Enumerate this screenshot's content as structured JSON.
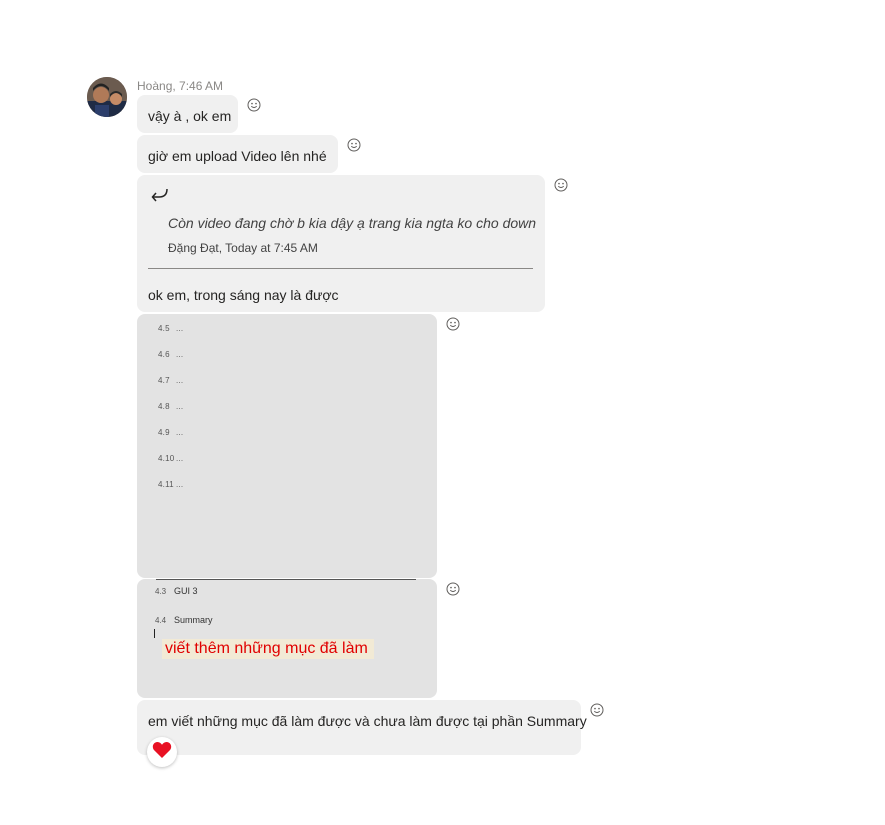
{
  "sender": {
    "name_time": "Hoàng, 7:46 AM"
  },
  "messages": [
    {
      "text": "vậy à , ok em"
    },
    {
      "text": "giờ em upload Video lên nhé"
    },
    {
      "reply": {
        "quoted_text": "Còn video đang chờ b kia dậy ạ trang kia ngta ko cho down",
        "quoted_meta": "Đặng Đạt, Today at 7:45 AM"
      },
      "text": "ok em, trong sáng nay là được"
    },
    {
      "image_doc_lines": [
        {
          "num": "4.5",
          "dots": "..."
        },
        {
          "num": "4.6",
          "dots": "..."
        },
        {
          "num": "4.7",
          "dots": "..."
        },
        {
          "num": "4.8",
          "dots": "..."
        },
        {
          "num": "4.9",
          "dots": "..."
        },
        {
          "num": "4.10",
          "dots": "..."
        },
        {
          "num": "4.11",
          "dots": "..."
        }
      ]
    },
    {
      "image_doc_heads": [
        {
          "num": "4.3",
          "label": "GUI 3"
        },
        {
          "num": "4.4",
          "label": "Summary"
        }
      ],
      "annotation": "viết thêm những mục đã làm"
    },
    {
      "text": "em viết những mục đã làm được và chưa làm được tại phần Summary",
      "reaction": "heart"
    }
  ],
  "icons": {
    "reaction_button": "smiley-icon",
    "reply": "reply-arrow-icon",
    "reaction": "heart-icon"
  },
  "colors": {
    "bubble": "#f0f0f0",
    "image_bg": "#e3e3e3",
    "annotation_text": "#e00000",
    "heart": "#e81123"
  }
}
